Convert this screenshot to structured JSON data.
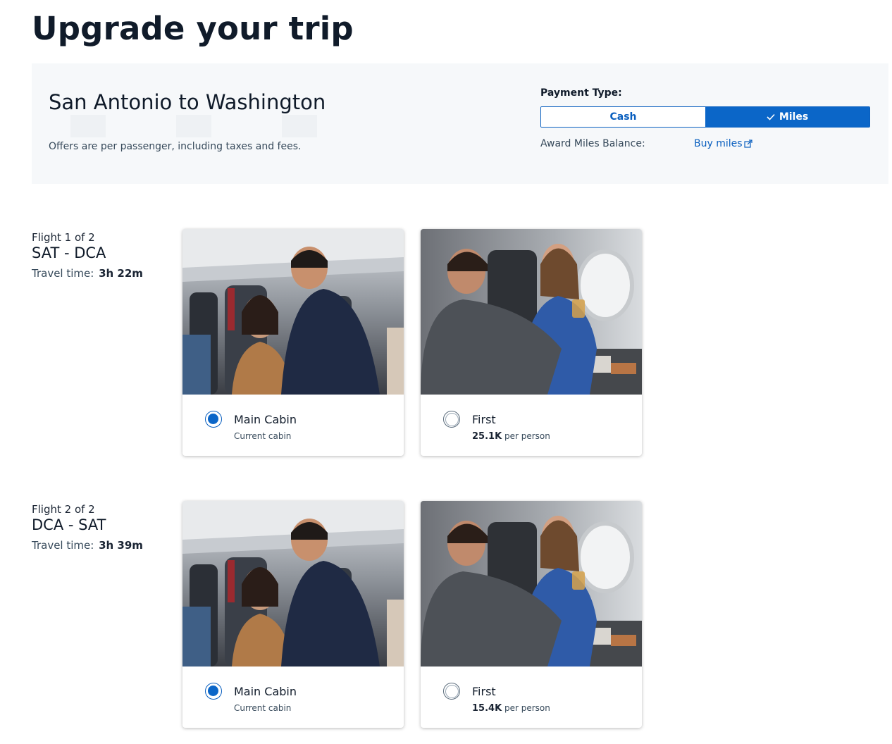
{
  "page": {
    "title": "Upgrade your trip"
  },
  "summary": {
    "route": "San Antonio to Washington",
    "note": "Offers are per passenger, including taxes and fees."
  },
  "payment": {
    "label": "Payment Type:",
    "options": [
      "Cash",
      "Miles"
    ],
    "selected": "Miles",
    "balance_label": "Award Miles Balance:",
    "buy_link": "Buy miles"
  },
  "flights": [
    {
      "count": "Flight 1 of 2",
      "route": "SAT - DCA",
      "travel_label": "Travel time:",
      "travel_time": "3h 22m",
      "cabins": [
        {
          "name": "Main Cabin",
          "sub": "Current cabin",
          "selected": true
        },
        {
          "name": "First",
          "price": "25.1K",
          "price_suffix": "per person",
          "selected": false
        }
      ]
    },
    {
      "count": "Flight 2 of 2",
      "route": "DCA - SAT",
      "travel_label": "Travel time:",
      "travel_time": "3h 39m",
      "cabins": [
        {
          "name": "Main Cabin",
          "sub": "Current cabin",
          "selected": true
        },
        {
          "name": "First",
          "price": "15.4K",
          "price_suffix": "per person",
          "selected": false
        }
      ]
    }
  ],
  "icons": {
    "miles_check": "check-icon",
    "buy_link": "external-link-icon"
  },
  "colors": {
    "accent": "#0b66c8",
    "panel": "#f6f8fa",
    "text": "#101b2a"
  }
}
